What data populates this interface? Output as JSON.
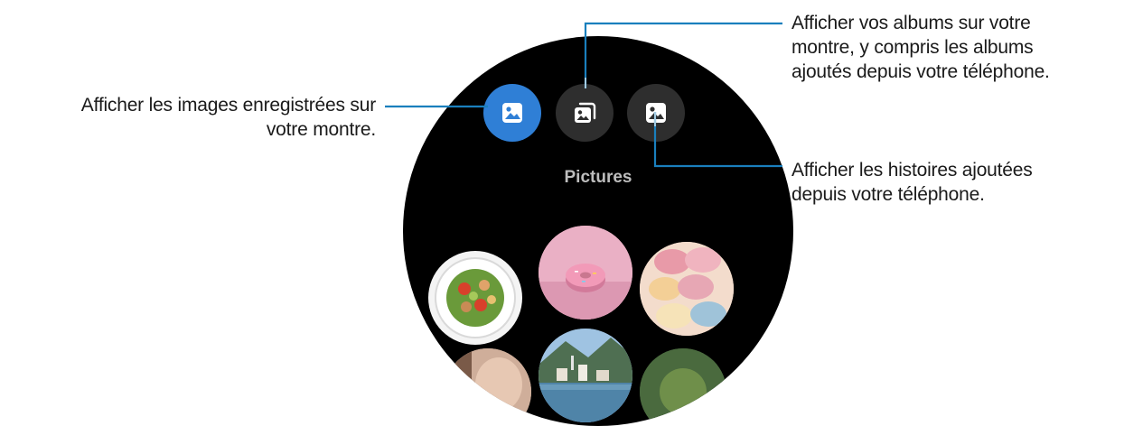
{
  "callouts": {
    "images": [
      "Afficher les images enregistrées sur",
      "votre montre."
    ],
    "albums": [
      "Afficher vos albums sur votre",
      "montre, y compris les albums",
      "ajoutés depuis votre téléphone."
    ],
    "stories": [
      "Afficher les histoires ajoutées",
      "depuis votre téléphone."
    ]
  },
  "watch": {
    "tabs": [
      {
        "name": "pictures-tab",
        "icon": "image-icon",
        "active": true
      },
      {
        "name": "albums-tab",
        "icon": "albums-icon",
        "active": false
      },
      {
        "name": "stories-tab",
        "icon": "stories-icon",
        "active": false
      }
    ],
    "section_title": "Pictures",
    "thumbnails": [
      "salad-photo",
      "donut-photo",
      "macarons-photo",
      "lake-village-photo",
      "portrait-photo",
      "food-photo"
    ]
  },
  "colors": {
    "callout_line": "#1a7fbd",
    "active_tab": "#2f7fd6",
    "inactive_tab": "#2e2e2e",
    "watch_bg": "#000000",
    "title_text": "#bdbdbd"
  }
}
